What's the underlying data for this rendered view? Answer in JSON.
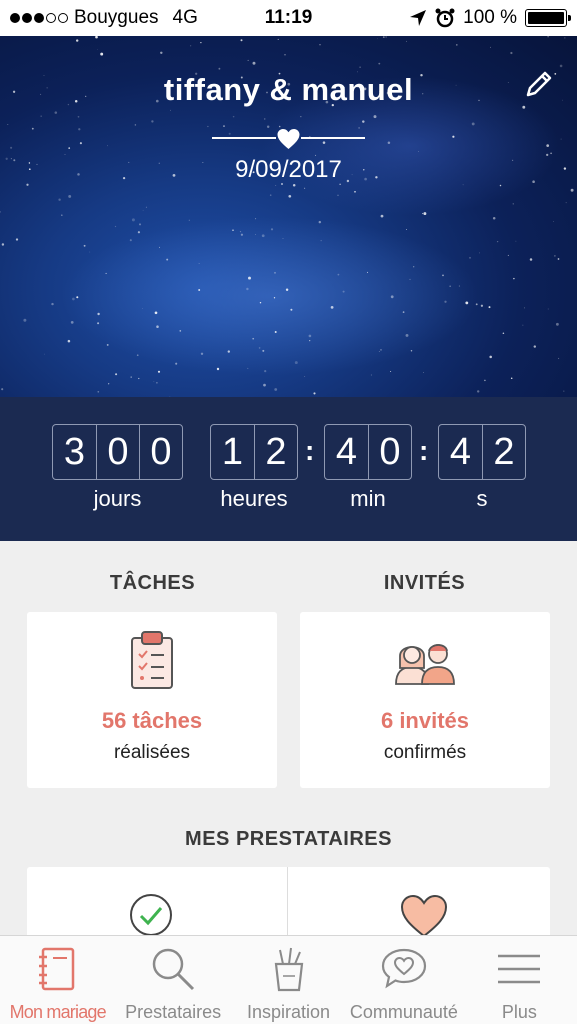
{
  "status_bar": {
    "carrier": "Bouygues",
    "network": "4G",
    "time": "11:19",
    "battery": "100 %"
  },
  "hero": {
    "couple": "tiffany & manuel",
    "date": "9/09/2017"
  },
  "countdown": {
    "days": {
      "digits": [
        "3",
        "0",
        "0"
      ],
      "label": "jours"
    },
    "hours": {
      "digits": [
        "1",
        "2"
      ],
      "label": "heures"
    },
    "minutes": {
      "digits": [
        "4",
        "0"
      ],
      "label": "min"
    },
    "seconds": {
      "digits": [
        "4",
        "2"
      ],
      "label": "s"
    },
    "separator": ":"
  },
  "tasks": {
    "title": "TÂCHES",
    "count_label": "56 tâches",
    "sub_label": "réalisées"
  },
  "guests": {
    "title": "INVITÉS",
    "count_label": "6 invités",
    "sub_label": "confirmés"
  },
  "vendors": {
    "title": "MES PRESTATAIRES"
  },
  "tabs": [
    {
      "label": "Mon mariage",
      "icon": "notebook-icon",
      "active": true
    },
    {
      "label": "Prestataires",
      "icon": "search-icon",
      "active": false
    },
    {
      "label": "Inspiration",
      "icon": "pencil-cup-icon",
      "active": false
    },
    {
      "label": "Communauté",
      "icon": "chat-heart-icon",
      "active": false
    },
    {
      "label": "Plus",
      "icon": "menu-icon",
      "active": false
    }
  ],
  "colors": {
    "accent": "#e2766b",
    "countdown_bg": "#1b2a51",
    "hero_bg": "#0c2159"
  }
}
